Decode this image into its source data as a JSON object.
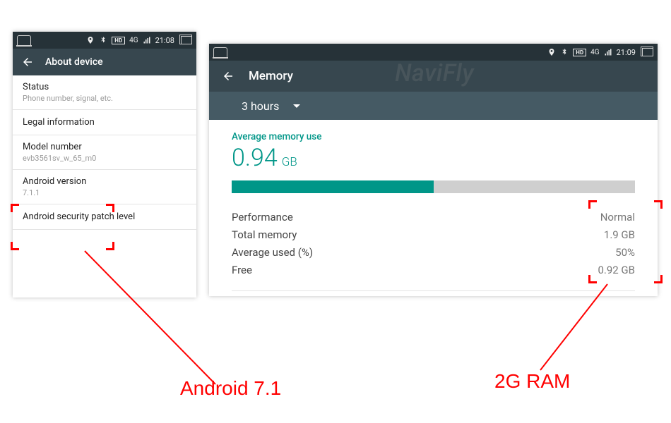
{
  "statusbar": {
    "hd": "HD",
    "net4g": "4G",
    "time": "21:08",
    "time2": "21:09"
  },
  "about": {
    "title": "About device",
    "status": {
      "label": "Status",
      "sub": "Phone number, signal, etc."
    },
    "legal": "Legal information",
    "model": {
      "label": "Model number",
      "value": "evb3561sv_w_65_m0"
    },
    "android": {
      "label": "Android version",
      "value": "7.1.1"
    },
    "patch": "Android security patch level"
  },
  "memory": {
    "title": "Memory",
    "dropdown": "3 hours",
    "avg_label": "Average memory use",
    "avg_value": "0.94",
    "avg_unit": "GB",
    "bar_pct": 50,
    "rows": {
      "perf": {
        "k": "Performance",
        "v": "Normal"
      },
      "total": {
        "k": "Total memory",
        "v": "1.9 GB"
      },
      "avgp": {
        "k": "Average used (%)",
        "v": "50%"
      },
      "free": {
        "k": "Free",
        "v": "0.92 GB"
      }
    }
  },
  "annotations": {
    "android": "Android 7.1",
    "ram": "2G RAM"
  },
  "watermark": "NaviFly"
}
